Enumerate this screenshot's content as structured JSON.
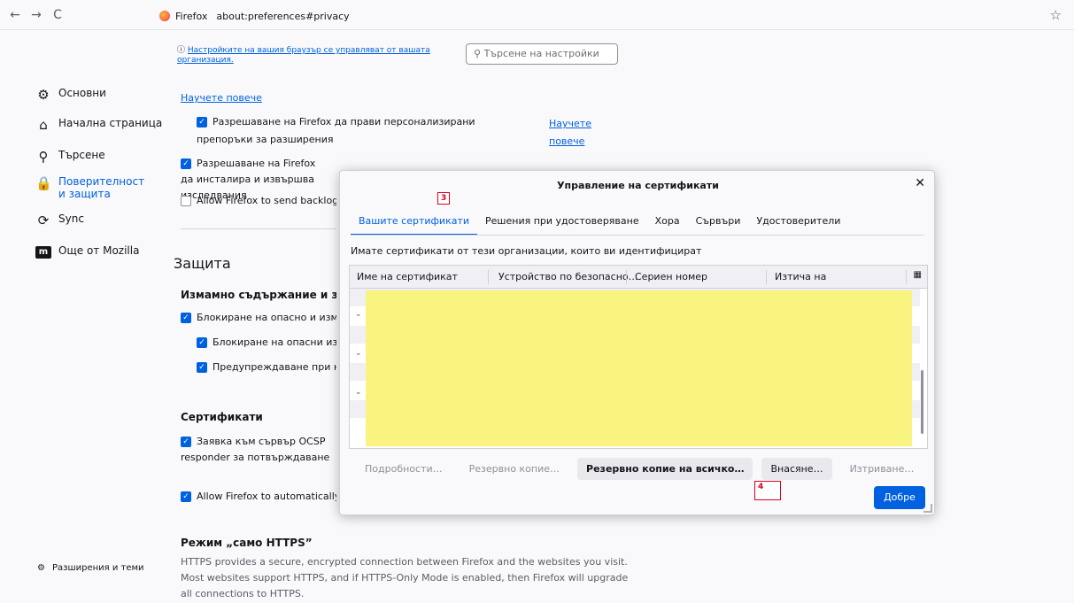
{
  "browser": {
    "back": "←",
    "forward": "→",
    "reload": "C",
    "identity_label": "Firefox",
    "url": "about:preferences#privacy"
  },
  "sidebar": {
    "items": [
      {
        "label": "Основни",
        "icon": "gear-icon"
      },
      {
        "label": "Начална страница",
        "icon": "home-icon"
      },
      {
        "label": "Търсене",
        "icon": "search-icon"
      },
      {
        "label": "Поверителност и защита",
        "icon": "lock-icon"
      },
      {
        "label": "Sync",
        "icon": "sync-icon"
      },
      {
        "label": "Още от Mozilla",
        "icon": "mozilla-icon"
      }
    ],
    "extensions_label": "Разширения и теми"
  },
  "content": {
    "org_notice": "Настройките на вашия браузър се управляват от вашата организация.",
    "search_placeholder": "Търсене на настройки",
    "learn_more": "Научете повече",
    "rec_ext_label": "Разрешаване на Firefox да прави персонализирани препоръки за разширения",
    "rec_ext_link": "Научете повече",
    "studies_label": "Разрешаване на Firefox да инсталира и извършва изследвания",
    "backlogged_label": "Allow Firefox to send backlogged crash reports",
    "protection_heading": "Защита",
    "deceptive_heading": "Измамно съдържание и защита",
    "block_dangerous": "Блокиране на опасно и измамно съдържание",
    "block_downloads": "Блокиране на опасни изтегляния",
    "warn_unwanted": "Предупреждаване при нежелан софтуер",
    "certs_heading": "Сертификати",
    "ocsp_label": "Заявка към сървър OCSP responder за потвърждаване на валидността на сертификатите",
    "auto_trust": "Allow Firefox to automatically trust third-party root certificates",
    "https_heading": "Режим „само HTTPS”",
    "https_desc": "HTTPS provides a secure, encrypted connection between Firefox and the websites you visit. Most websites support HTTPS, and if HTTPS-Only Mode is enabled, then Firefox will upgrade all connections to HTTPS."
  },
  "dialog": {
    "title": "Управление на сертификати",
    "tabs": [
      "Вашите сертификати",
      "Решения при удостоверяване",
      "Хора",
      "Сървъри",
      "Удостоверители"
    ],
    "description": "Имате сертификати от тези организации, които ви идентифицират",
    "columns": [
      "Име на сертификат",
      "Устройство по безопасно…",
      "Сериен номер",
      "Изтича на"
    ],
    "buttons": {
      "details": "Подробности…",
      "backup": "Резервно копие…",
      "backup_all": "Резервно копие на всичко…",
      "import": "Внасяне…",
      "delete": "Изтриване…",
      "ok": "Добре"
    },
    "markers": [
      "3",
      "4"
    ]
  },
  "colors": {
    "accent": "#0061e0",
    "redaction": "#f8f47f",
    "marker": "#d70022"
  }
}
